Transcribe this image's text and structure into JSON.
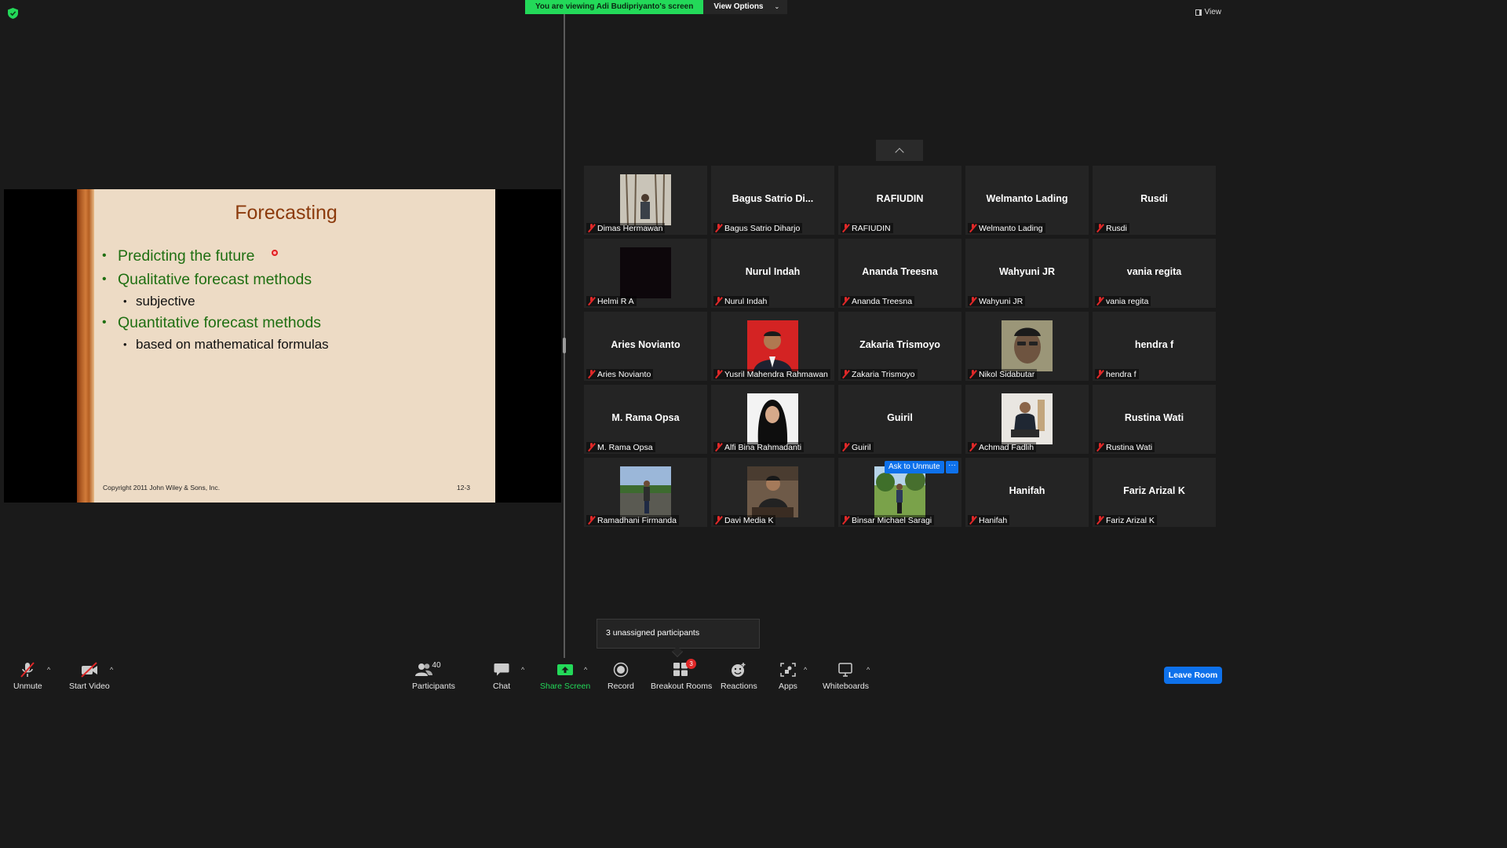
{
  "top": {
    "viewing_text": "You are viewing Adi Budipriyanto's screen",
    "view_options": "View Options",
    "view_label": "View"
  },
  "slide": {
    "title": "Forecasting",
    "bullet1": "Predicting the future",
    "bullet2": "Qualitative forecast methods",
    "sub2": "subjective",
    "bullet3": "Quantitative forecast methods",
    "sub3": "based on mathematical formulas",
    "copyright": "Copyright 2011 John Wiley & Sons, Inc.",
    "page": "12-3"
  },
  "participants": [
    {
      "name": "Dimas Hermawan",
      "big": "",
      "photo": "photo-forest"
    },
    {
      "name": "Bagus Satrio Diharjo",
      "big": "Bagus  Satrio  Di...",
      "photo": ""
    },
    {
      "name": "RAFIUDIN",
      "big": "RAFIUDIN",
      "photo": ""
    },
    {
      "name": "Welmanto Lading",
      "big": "Welmanto Lading",
      "photo": ""
    },
    {
      "name": "Rusdi",
      "big": "Rusdi",
      "photo": ""
    },
    {
      "name": "Helmi R A",
      "big": "",
      "photo": "photo-dark"
    },
    {
      "name": "Nurul Indah",
      "big": "Nurul Indah",
      "photo": ""
    },
    {
      "name": "Ananda Treesna",
      "big": "Ananda Treesna",
      "photo": ""
    },
    {
      "name": "Wahyuni JR",
      "big": "Wahyuni JR",
      "photo": ""
    },
    {
      "name": "vania regita",
      "big": "vania regita",
      "photo": ""
    },
    {
      "name": "Aries Novianto",
      "big": "Aries Novianto",
      "photo": ""
    },
    {
      "name": "Yusril Mahendra Rahmawan",
      "big": "",
      "photo": "photo-redbg"
    },
    {
      "name": "Zakaria Trismoyo",
      "big": "Zakaria Trismoyo",
      "photo": ""
    },
    {
      "name": "Nikol Sidabutar",
      "big": "",
      "photo": "photo-face"
    },
    {
      "name": "hendra f",
      "big": "hendra f",
      "photo": ""
    },
    {
      "name": "M. Rama Opsa",
      "big": "M. Rama Opsa",
      "photo": ""
    },
    {
      "name": "Alfi Bina Rahmadanti",
      "big": "",
      "photo": "photo-hijab"
    },
    {
      "name": "Guiril",
      "big": "Guiril",
      "photo": ""
    },
    {
      "name": "Achmad Fadlih",
      "big": "",
      "photo": "photo-suit"
    },
    {
      "name": "Rustina Wati",
      "big": "Rustina Wati",
      "photo": ""
    },
    {
      "name": "Ramadhani Firmanda",
      "big": "",
      "photo": "photo-street"
    },
    {
      "name": "Davi Media K",
      "big": "",
      "photo": "photo-cafe"
    },
    {
      "name": "Binsar Michael Saragi",
      "big": "",
      "photo": "photo-park"
    },
    {
      "name": "Hanifah",
      "big": "Hanifah",
      "photo": ""
    },
    {
      "name": "Fariz Arizal K",
      "big": "Fariz Arizal K",
      "photo": ""
    }
  ],
  "hover": {
    "ask_unmute": "Ask to Unmute",
    "more": "···"
  },
  "toast": "3 unassigned participants",
  "toolbar": {
    "unmute": "Unmute",
    "start_video": "Start Video",
    "participants": "Participants",
    "participants_count": "40",
    "chat": "Chat",
    "share_screen": "Share Screen",
    "record": "Record",
    "breakout_rooms": "Breakout Rooms",
    "breakout_count": "3",
    "reactions": "Reactions",
    "apps": "Apps",
    "whiteboards": "Whiteboards",
    "leave_room": "Leave Room",
    "caret": "^"
  },
  "colors": {
    "share_green": "#23d959",
    "accent_blue": "#0e71eb",
    "muted_red": "#e02828",
    "slide_title": "#8c3b0d",
    "slide_green": "#1f6f12"
  }
}
